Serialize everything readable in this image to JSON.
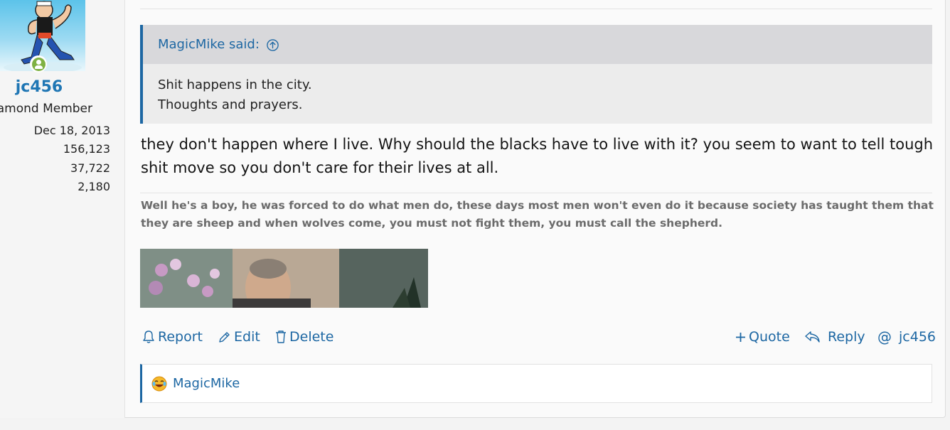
{
  "user": {
    "username": "jc456",
    "title": "Diamond Member",
    "joined": "Dec 18, 2013",
    "messages": "156,123",
    "reactions": "37,722",
    "points": "2,180"
  },
  "quote": {
    "author_label": "MagicMike said:",
    "lines": [
      "Shit happens in the city.",
      "Thoughts and prayers."
    ]
  },
  "post": {
    "body": "they don't happen where I live. Why should the blacks have to live with it? you seem to want to tell tough shit move so you don't care for their lives at all."
  },
  "signature": {
    "text": "Well he's a boy, he was forced to do what men do, these days most men won't even do it because society has taught them that they are sheep and when wolves come, you must not fight them, you must call the shepherd."
  },
  "actions": {
    "report": "Report",
    "edit": "Edit",
    "delete": "Delete",
    "quote": "Quote",
    "reply": "Reply",
    "mention": "jc456"
  },
  "reactions": {
    "icon": "laughing-face-icon",
    "users": "MagicMike"
  },
  "colors": {
    "accent": "#1d67a3",
    "username": "#1f76b4",
    "online": "#7fb142",
    "quote_header": "#d8d8db",
    "quote_body": "#ececec"
  }
}
